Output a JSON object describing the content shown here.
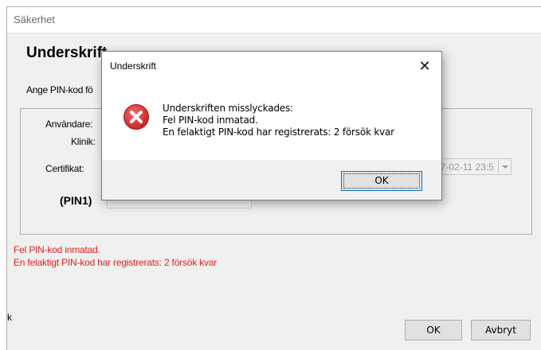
{
  "window": {
    "title": "Säkerhet"
  },
  "main": {
    "heading": "Underskrift",
    "prompt": "Ange PIN-kod fö",
    "labels": {
      "user": "Användare:",
      "clinic": "Klinik:",
      "certificate": "Certifikat:",
      "pin": "(PIN1)"
    },
    "certificate_value": "27-02-11 23:5",
    "errors": [
      "Fel PIN-kod inmatad.",
      "En felaktigt PIN-kod har registrerats: 2 försök kvar"
    ],
    "side_char": "k",
    "ok_label": "OK",
    "cancel_label": "Avbryt"
  },
  "modal": {
    "title": "Underskrift",
    "close_glyph": "✕",
    "icon": "error-icon",
    "lines": [
      "Underskriften misslyckades:",
      "Fel PIN-kod inmatad.",
      "En felaktigt PIN-kod har registrerats: 2 försök kvar"
    ],
    "ok_label": "OK"
  },
  "colors": {
    "error_text": "#e02020",
    "error_icon": "#d62b2b",
    "focus_border": "#0078d7"
  }
}
